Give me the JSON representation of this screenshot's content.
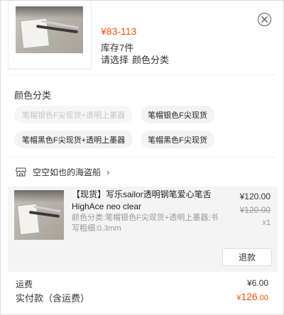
{
  "product": {
    "price_range": "¥83-113",
    "stock": "库存7件",
    "select_hint": "请选择",
    "select_hint_attr": "颜色分类"
  },
  "options": {
    "title": "颜色分类",
    "chips": [
      {
        "label": "笔帽银色F尖现货+透明上墨器",
        "disabled": true
      },
      {
        "label": "笔帽银色F尖现货",
        "disabled": false
      },
      {
        "label": "笔帽黑色F尖现货+透明上墨器",
        "disabled": false
      },
      {
        "label": "笔帽黑色F尖现货",
        "disabled": false
      }
    ]
  },
  "shop": {
    "name": "空空如也的海盗船",
    "arrow": "›",
    "icon": "store-icon"
  },
  "order": {
    "title": "【现货】写乐sailor透明钢笔爱心笔舌HighAce neo clear",
    "spec": "颜色分类:笔帽银色F尖现货+透明上墨器;书写粗细:0.3mm",
    "price": "¥120.00",
    "original_price": "¥120.00",
    "quantity": "x1",
    "refund_label": "退款"
  },
  "summary": {
    "shipping_label": "运费",
    "shipping_value": "¥6.00",
    "total_label": "实付款（含运费）",
    "total_currency": "¥",
    "total_int": "126",
    "total_dec": ".00"
  },
  "colors": {
    "accent": "#ff5000",
    "card_bg": "#f4f4f4",
    "chip_bg": "#f3f3f3"
  }
}
